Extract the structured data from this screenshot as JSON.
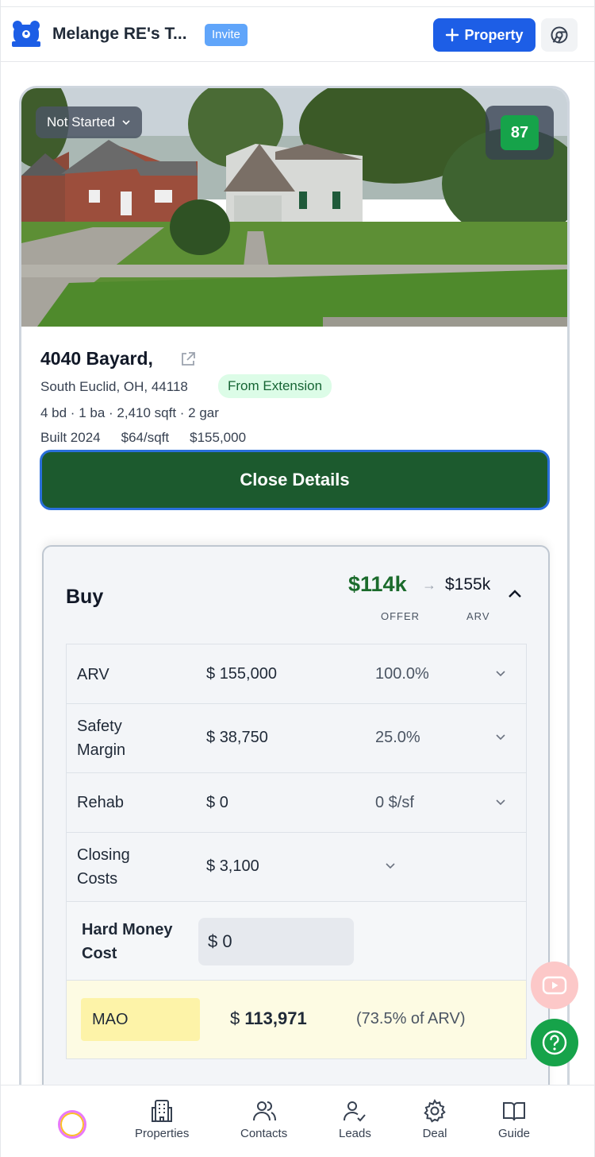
{
  "header": {
    "org_name": "Melange RE's T...",
    "invite_label": "Invite",
    "add_property_label": "Property",
    "icons": [
      "bear-logo-icon",
      "plus-icon",
      "chrome-icon"
    ]
  },
  "property": {
    "status": "Not Started",
    "score": "87",
    "address": "4040 Bayard,",
    "city_line": "South Euclid, OH, 44118",
    "source_badge": "From Extension",
    "specs": "4 bd · 1 ba · 2,410 sqft · 2 gar",
    "built": "Built 2024",
    "price_per_sqft": "$64/sqft",
    "price": "$155,000",
    "close_details_label": "Close Details"
  },
  "buy": {
    "title": "Buy",
    "offer_value": "$114k",
    "arv_value": "$155k",
    "offer_caption": "OFFER",
    "arv_caption": "ARV",
    "rows": [
      {
        "label": "ARV",
        "currency": "$",
        "amount": "155,000",
        "percent": "100.0%"
      },
      {
        "label": "Safety Margin",
        "currency": "$",
        "amount": "38,750",
        "percent": "25.0%"
      },
      {
        "label": "Rehab",
        "currency": "$",
        "amount": "0",
        "percent": "0 $/sf"
      },
      {
        "label": "Closing Costs",
        "currency": "$",
        "amount": "3,100",
        "percent": ""
      },
      {
        "label": "Hard Money Cost",
        "currency": "$",
        "amount": "0",
        "percent": ""
      }
    ],
    "mao": {
      "label": "MAO",
      "currency": "$",
      "amount": "113,971",
      "percent": "(73.5% of ARV)"
    }
  },
  "nav": {
    "items": [
      "Properties",
      "Contacts",
      "Leads",
      "Deal",
      "Guide"
    ]
  },
  "colors": {
    "primary_blue": "#1d5ee6",
    "close_button_green": "#1c5a2e",
    "offer_green": "#1b6b2c",
    "score_green": "#16a34a",
    "mao_highlight": "#fdf3a8"
  }
}
